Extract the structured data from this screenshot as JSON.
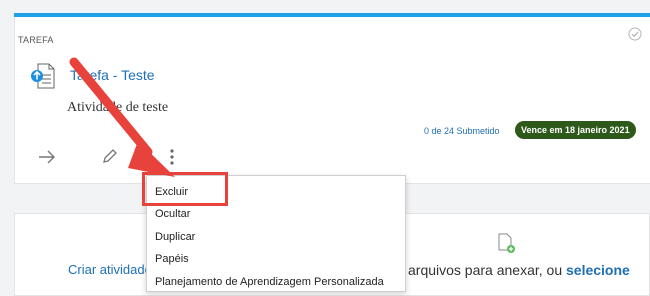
{
  "card": {
    "type_label": "TAREFA",
    "title": "Tarefa - Teste",
    "description": "Atividade de teste",
    "submitted": "0 de 24 Submetido",
    "due": "Vence em 18 janeiro 2021"
  },
  "icons": {
    "check": "check-circle-icon",
    "document": "assignment-document-icon",
    "open": "arrow-right-icon",
    "edit": "pencil-icon",
    "more": "kebab-menu-icon",
    "upload": "file-add-icon"
  },
  "lower": {
    "create_link": "Criar atividade",
    "drop_text": "arquivos para anexar, ou ",
    "select_link": "selecione"
  },
  "menu": {
    "items": [
      "Excluir",
      "Ocultar",
      "Duplicar",
      "Papéis",
      "Planejamento de Aprendizagem Personalizada"
    ]
  },
  "colors": {
    "accent": "#1ea1e6",
    "link": "#1f6fb6",
    "due_badge": "#2d5a1a",
    "annotation": "#e8423c"
  }
}
